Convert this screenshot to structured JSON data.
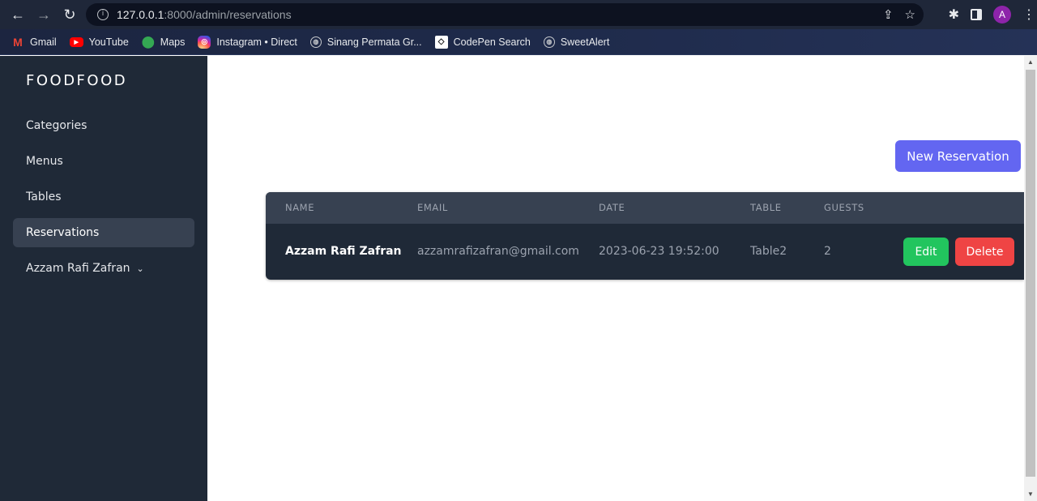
{
  "browser": {
    "url_host": "127.0.0.1",
    "url_path": ":8000/admin/reservations",
    "avatar_letter": "A",
    "bookmarks": [
      {
        "label": "Gmail",
        "icon": "gmail-icon"
      },
      {
        "label": "YouTube",
        "icon": "youtube-icon"
      },
      {
        "label": "Maps",
        "icon": "maps-icon"
      },
      {
        "label": "Instagram • Direct",
        "icon": "instagram-icon"
      },
      {
        "label": "Sinang Permata Gr...",
        "icon": "globe-icon"
      },
      {
        "label": "CodePen Search",
        "icon": "codepen-icon"
      },
      {
        "label": "SweetAlert",
        "icon": "globe-icon"
      }
    ]
  },
  "sidebar": {
    "brand": "FOODFOOD",
    "items": [
      {
        "label": "Categories"
      },
      {
        "label": "Menus"
      },
      {
        "label": "Tables"
      },
      {
        "label": "Reservations",
        "active": true
      },
      {
        "label": "Azzam Rafi Zafran"
      }
    ]
  },
  "main": {
    "new_button": "New Reservation",
    "table": {
      "headers": [
        "NAME",
        "EMAIL",
        "DATE",
        "TABLE",
        "GUESTS"
      ],
      "rows": [
        {
          "name": "Azzam Rafi Zafran",
          "email": "azzamrafizafran@gmail.com",
          "date": "2023-06-23 19:52:00",
          "table": "Table2",
          "guests": "2",
          "edit": "Edit",
          "delete": "Delete"
        }
      ]
    }
  },
  "colors": {
    "sidebar_bg": "#1f2937",
    "primary": "#6366f1",
    "edit": "#22c55e",
    "delete": "#ef4444"
  }
}
